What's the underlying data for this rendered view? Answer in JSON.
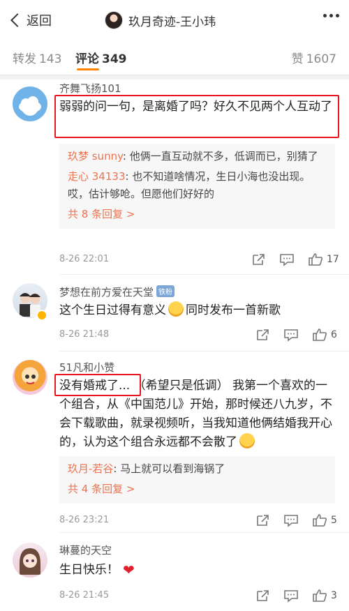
{
  "header": {
    "back_label": "返回",
    "title": "玖月奇迹-王小玮"
  },
  "tabs": {
    "repost_label": "转发",
    "repost_count": "143",
    "comment_label": "评论",
    "comment_count": "349",
    "like_label": "赞",
    "like_count": "1607"
  },
  "comments": [
    {
      "user": "齐舞飞扬101",
      "text": "弱弱的问一句，是离婚了吗？好久不见两个人互动了",
      "replies": [
        {
          "user": "玖梦 sunny",
          "text": ": 他俩一直互动就不多，低调而已，别猜了"
        },
        {
          "user": "走心 34133",
          "text": ": 也不知道啥情况，生日小海也没出现。 哎，估计够呛。但愿他们好好的"
        }
      ],
      "more_replies": "共 8 条回复 >",
      "time": "8-26 22:01",
      "likes": "17"
    },
    {
      "user": "梦想在前方爱在天堂",
      "badge": "铁粉",
      "text": "这个生日过得有意义",
      "text2": "同时发布一首新歌",
      "time": "8-26 21:48",
      "likes": "6"
    },
    {
      "user": "51凡和小赞",
      "text_highlight": "没有婚戒了...",
      "text": "（希望只是低调） 我第一个喜欢的一个组合，从《中国范儿》开始，那时候还八九岁，不会下载歌曲，就录视频听，当我知道他俩结婚我开心的，认为这个组合永远都不会散了",
      "replies": [
        {
          "user": "玖月-若谷",
          "text": ": 马上就可以看到海锅了"
        }
      ],
      "more_replies": "共 4 条回复 >",
      "time": "8-26 23:21",
      "likes": "5"
    },
    {
      "user": "琳蔓的天空",
      "text": "生日快乐！",
      "time": "8-26 21:45",
      "likes": "3"
    }
  ],
  "colors": {
    "accent": "#ff8200",
    "link": "#eb7350",
    "highlight_box": "#e6161e"
  },
  "icons": [
    "back-chevron-icon",
    "more-dots-icon",
    "share-icon",
    "comment-icon",
    "like-thumb-icon",
    "heart-emoji-icon",
    "blush-emoji-icon",
    "crying-emoji-icon"
  ]
}
